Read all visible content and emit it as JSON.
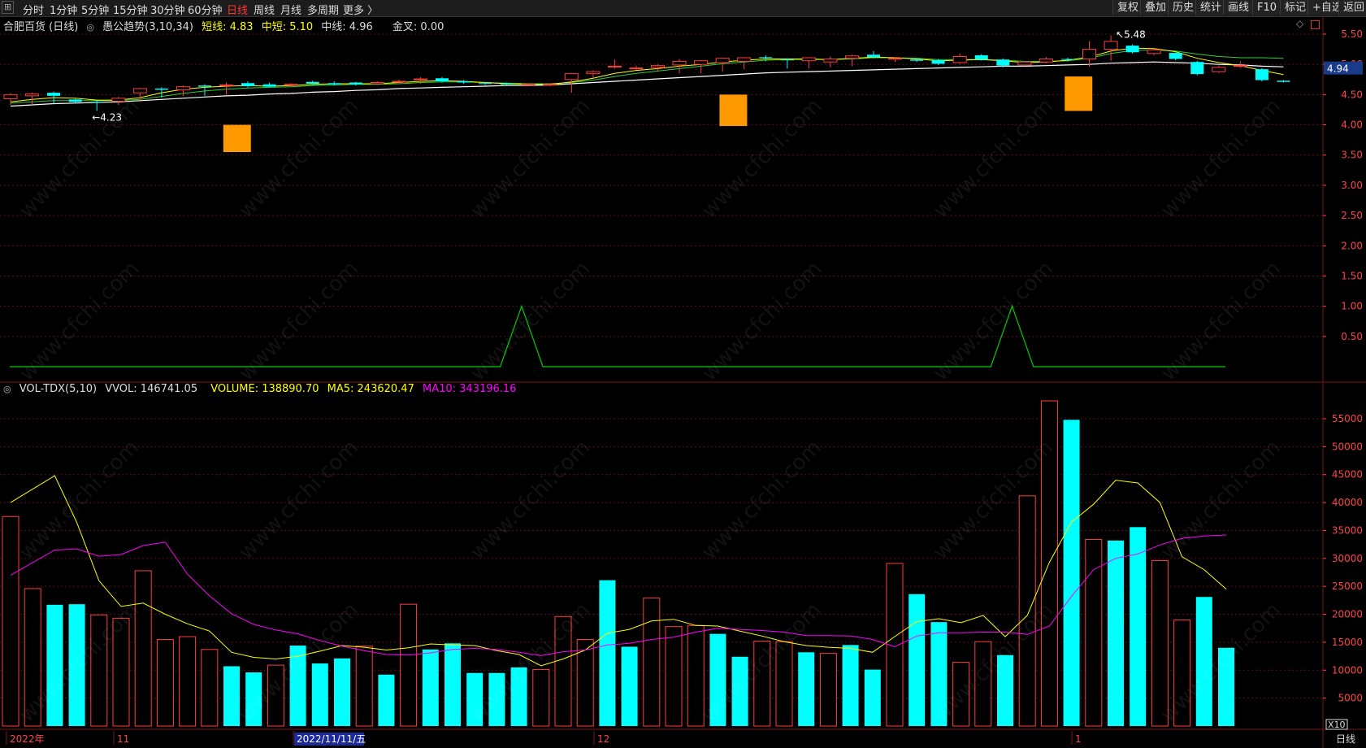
{
  "toolbar": {
    "menu_icon": "window-menu-icon",
    "periods": [
      "分时",
      "1分钟",
      "5分钟",
      "15分钟",
      "30分钟",
      "60分钟",
      "日线",
      "周线",
      "月线",
      "多周期",
      "更多 〉"
    ],
    "active_period": "日线",
    "right_buttons": [
      "复权",
      "叠加",
      "历史",
      "统计",
      "画线",
      "F10",
      "标记",
      "+自选",
      "返回"
    ]
  },
  "price_panel": {
    "stock_name": "合肥百货 (日线)",
    "indicator_name": "愚公趋势(3,10,34)",
    "short_label": "短线: 4.83",
    "mid_short_label": "中短: 5.10",
    "mid_label": "中线: 4.96",
    "golden_cross_label": "金叉: 0.00",
    "high_marker": "5.48",
    "low_marker": "4.23",
    "current_price_tag": "4.94",
    "diamond_icon": "diamond-icon",
    "settings_icon": "square-icon",
    "y_ticks": [
      "5.50",
      "5.00",
      "4.50",
      "4.00",
      "3.50",
      "3.00",
      "2.50",
      "2.00",
      "1.50",
      "1.00",
      "0.50"
    ]
  },
  "volume_panel": {
    "indicator_name": "VOL-TDX(5,10)",
    "vvol_label": "VVOL: 146741.05",
    "volume_label": "VOLUME: 138890.70",
    "ma5_label": "MA5: 243620.47",
    "ma10_label": "MA10: 343196.16",
    "y_ticks": [
      "55000",
      "50000",
      "45000",
      "40000",
      "35000",
      "30000",
      "25000",
      "20000",
      "15000",
      "10000",
      "5000"
    ],
    "unit_badge": "X10"
  },
  "x_axis": {
    "labels": [
      "2022年",
      "11",
      "2022/11/11/五",
      "12",
      "1"
    ],
    "period_badge": "日线"
  },
  "watermark_text": "www.cfchi.com",
  "colors": {
    "up": "#ff3d3d",
    "down": "#00ffff",
    "short_line": "#ffff00",
    "mid_line": "#ffffff",
    "ma10_line": "#ff00ff",
    "signal_line": "#00cc00",
    "block": "#ff9900",
    "grid": "#5a1010",
    "axis_text": "#ff4444"
  },
  "chart_data": {
    "type": "candlestick",
    "price_axis_range": [
      0,
      5.7
    ],
    "volume_axis_range": [
      0,
      59500
    ],
    "candles": [
      {
        "o": 4.43,
        "c": 4.5,
        "h": 4.52,
        "l": 4.33
      },
      {
        "o": 4.48,
        "c": 4.51,
        "h": 4.53,
        "l": 4.33
      },
      {
        "o": 4.53,
        "c": 4.48,
        "h": 4.55,
        "l": 4.35
      },
      {
        "o": 4.42,
        "c": 4.38,
        "h": 4.43,
        "l": 4.36
      },
      {
        "o": 4.38,
        "c": 4.37,
        "h": 4.4,
        "l": 4.23
      },
      {
        "o": 4.39,
        "c": 4.44,
        "h": 4.46,
        "l": 4.33
      },
      {
        "o": 4.53,
        "c": 4.6,
        "h": 4.61,
        "l": 4.38
      },
      {
        "o": 4.6,
        "c": 4.58,
        "h": 4.62,
        "l": 4.45
      },
      {
        "o": 4.58,
        "c": 4.63,
        "h": 4.65,
        "l": 4.48
      },
      {
        "o": 4.65,
        "c": 4.63,
        "h": 4.67,
        "l": 4.48
      },
      {
        "o": 4.65,
        "c": 4.66,
        "h": 4.7,
        "l": 4.5
      },
      {
        "o": 4.69,
        "c": 4.64,
        "h": 4.72,
        "l": 4.62
      },
      {
        "o": 4.67,
        "c": 4.63,
        "h": 4.7,
        "l": 4.62
      },
      {
        "o": 4.66,
        "c": 4.67,
        "h": 4.69,
        "l": 4.64
      },
      {
        "o": 4.71,
        "c": 4.68,
        "h": 4.73,
        "l": 4.66
      },
      {
        "o": 4.69,
        "c": 4.67,
        "h": 4.72,
        "l": 4.65
      },
      {
        "o": 4.7,
        "c": 4.67,
        "h": 4.71,
        "l": 4.65
      },
      {
        "o": 4.68,
        "c": 4.7,
        "h": 4.72,
        "l": 4.66
      },
      {
        "o": 4.71,
        "c": 4.72,
        "h": 4.75,
        "l": 4.68
      },
      {
        "o": 4.76,
        "c": 4.76,
        "h": 4.79,
        "l": 4.68
      },
      {
        "o": 4.77,
        "c": 4.72,
        "h": 4.79,
        "l": 4.7
      },
      {
        "o": 4.72,
        "c": 4.7,
        "h": 4.74,
        "l": 4.68
      },
      {
        "o": 4.69,
        "c": 4.68,
        "h": 4.71,
        "l": 4.66
      },
      {
        "o": 4.68,
        "c": 4.67,
        "h": 4.7,
        "l": 4.65
      },
      {
        "o": 4.67,
        "c": 4.67,
        "h": 4.69,
        "l": 4.64
      },
      {
        "o": 4.66,
        "c": 4.67,
        "h": 4.69,
        "l": 4.64
      },
      {
        "o": 4.75,
        "c": 4.85,
        "h": 4.86,
        "l": 4.53
      },
      {
        "o": 4.85,
        "c": 4.88,
        "h": 4.9,
        "l": 4.78
      },
      {
        "o": 4.97,
        "c": 4.97,
        "h": 5.08,
        "l": 4.93
      },
      {
        "o": 4.94,
        "c": 4.94,
        "h": 4.98,
        "l": 4.91
      },
      {
        "o": 4.95,
        "c": 4.98,
        "h": 5.0,
        "l": 4.88
      },
      {
        "o": 4.99,
        "c": 5.05,
        "h": 5.09,
        "l": 4.85
      },
      {
        "o": 5.0,
        "c": 5.06,
        "h": 5.07,
        "l": 4.85
      },
      {
        "o": 5.03,
        "c": 5.1,
        "h": 5.11,
        "l": 4.88
      },
      {
        "o": 5.05,
        "c": 5.11,
        "h": 5.12,
        "l": 4.92
      },
      {
        "o": 5.12,
        "c": 5.11,
        "h": 5.15,
        "l": 5.05
      },
      {
        "o": 5.08,
        "c": 5.07,
        "h": 5.1,
        "l": 4.93
      },
      {
        "o": 5.06,
        "c": 5.11,
        "h": 5.12,
        "l": 4.93
      },
      {
        "o": 5.04,
        "c": 5.09,
        "h": 5.13,
        "l": 4.95
      },
      {
        "o": 5.1,
        "c": 5.14,
        "h": 5.16,
        "l": 4.97
      },
      {
        "o": 5.16,
        "c": 5.12,
        "h": 5.22,
        "l": 5.1
      },
      {
        "o": 5.09,
        "c": 5.1,
        "h": 5.12,
        "l": 5.04
      },
      {
        "o": 5.08,
        "c": 5.06,
        "h": 5.1,
        "l": 5.04
      },
      {
        "o": 5.07,
        "c": 5.01,
        "h": 5.09,
        "l": 4.99
      },
      {
        "o": 5.03,
        "c": 5.13,
        "h": 5.18,
        "l": 5.01
      },
      {
        "o": 5.15,
        "c": 5.08,
        "h": 5.17,
        "l": 5.06
      },
      {
        "o": 5.08,
        "c": 4.98,
        "h": 5.1,
        "l": 4.95
      },
      {
        "o": 4.99,
        "c": 5.04,
        "h": 5.05,
        "l": 4.97
      },
      {
        "o": 5.04,
        "c": 5.09,
        "h": 5.12,
        "l": 5.02
      },
      {
        "o": 5.09,
        "c": 5.08,
        "h": 5.11,
        "l": 5.05
      },
      {
        "o": 5.09,
        "c": 5.25,
        "h": 5.38,
        "l": 4.96
      },
      {
        "o": 5.25,
        "c": 5.38,
        "h": 5.48,
        "l": 5.06
      },
      {
        "o": 5.31,
        "c": 5.2,
        "h": 5.33,
        "l": 5.18
      },
      {
        "o": 5.18,
        "c": 5.24,
        "h": 5.26,
        "l": 5.15
      },
      {
        "o": 5.19,
        "c": 5.09,
        "h": 5.2,
        "l": 5.07
      },
      {
        "o": 5.04,
        "c": 4.84,
        "h": 5.06,
        "l": 4.82
      },
      {
        "o": 4.88,
        "c": 4.95,
        "h": 4.98,
        "l": 4.86
      },
      {
        "o": 4.97,
        "c": 4.98,
        "h": 5.05,
        "l": 4.94
      },
      {
        "o": 4.92,
        "c": 4.74,
        "h": 4.94,
        "l": 4.72
      },
      {
        "o": 4.73,
        "c": 4.71,
        "h": 4.74,
        "l": 4.7
      }
    ],
    "short_line": [
      4.38,
      4.42,
      4.45,
      4.44,
      4.41,
      4.41,
      4.45,
      4.53,
      4.59,
      4.62,
      4.64,
      4.65,
      4.64,
      4.65,
      4.67,
      4.68,
      4.68,
      4.68,
      4.7,
      4.72,
      4.73,
      4.72,
      4.7,
      4.68,
      4.67,
      4.67,
      4.71,
      4.77,
      4.85,
      4.9,
      4.93,
      4.97,
      5.0,
      5.04,
      5.07,
      5.09,
      5.09,
      5.09,
      5.08,
      5.1,
      5.12,
      5.11,
      5.09,
      5.06,
      5.07,
      5.08,
      5.06,
      5.03,
      5.04,
      5.07,
      5.12,
      5.22,
      5.27,
      5.26,
      5.21,
      5.1,
      5.03,
      4.98,
      4.9,
      4.83
    ],
    "mid_line": [
      4.31,
      4.33,
      4.35,
      4.36,
      4.37,
      4.38,
      4.4,
      4.42,
      4.44,
      4.46,
      4.48,
      4.49,
      4.51,
      4.52,
      4.54,
      4.55,
      4.57,
      4.58,
      4.6,
      4.61,
      4.62,
      4.63,
      4.64,
      4.65,
      4.65,
      4.66,
      4.68,
      4.7,
      4.72,
      4.74,
      4.76,
      4.78,
      4.8,
      4.82,
      4.84,
      4.86,
      4.87,
      4.88,
      4.89,
      4.9,
      4.91,
      4.92,
      4.93,
      4.94,
      4.95,
      4.96,
      4.97,
      4.97,
      4.98,
      4.99,
      5.0,
      5.02,
      5.03,
      5.04,
      5.03,
      5.02,
      5.0,
      4.99,
      4.97,
      4.96
    ],
    "mid_short_line": [
      4.36,
      4.38,
      4.4,
      4.4,
      4.4,
      4.4,
      4.42,
      4.47,
      4.52,
      4.56,
      4.59,
      4.61,
      4.62,
      4.63,
      4.65,
      4.66,
      4.67,
      4.67,
      4.68,
      4.7,
      4.71,
      4.71,
      4.7,
      4.69,
      4.68,
      4.68,
      4.7,
      4.74,
      4.8,
      4.85,
      4.89,
      4.93,
      4.97,
      5.01,
      5.04,
      5.07,
      5.08,
      5.08,
      5.08,
      5.09,
      5.11,
      5.11,
      5.1,
      5.08,
      5.08,
      5.08,
      5.07,
      5.05,
      5.05,
      5.06,
      5.1,
      5.18,
      5.23,
      5.24,
      5.22,
      5.17,
      5.13,
      5.11,
      5.11,
      5.1
    ],
    "signal_blocks": [
      {
        "index": 10,
        "top": 4.0,
        "bottom": 3.55
      },
      {
        "index": 33,
        "top": 4.5,
        "bottom": 3.98
      },
      {
        "index": 49,
        "top": 4.8,
        "bottom": 4.23
      }
    ],
    "signal_line": [
      0,
      0,
      0,
      0,
      0,
      0,
      0,
      0,
      0,
      0,
      0,
      0,
      0,
      0,
      0,
      0,
      0,
      0,
      0,
      0,
      0,
      0,
      0,
      0,
      1,
      0,
      0,
      0,
      0,
      0,
      0,
      0,
      0,
      0,
      0,
      0,
      0,
      0,
      0,
      0,
      0,
      0,
      0,
      0,
      0,
      0,
      0,
      1,
      0,
      0,
      0,
      0,
      0,
      0,
      0,
      0,
      0,
      0
    ],
    "signal_line_start_index": 0,
    "volumes": [
      37500,
      24600,
      21700,
      21800,
      19900,
      19300,
      27800,
      15500,
      16000,
      13700,
      10700,
      9600,
      10900,
      14400,
      11200,
      12100,
      14300,
      9200,
      21800,
      13700,
      14800,
      9500,
      9500,
      10500,
      10100,
      19600,
      15500,
      26100,
      14200,
      22900,
      17800,
      18000,
      16500,
      12400,
      15200,
      15100,
      13200,
      13000,
      14500,
      10100,
      29100,
      23600,
      18600,
      11400,
      15100,
      12700,
      41200,
      58200,
      54800,
      33400,
      33200,
      35600,
      29600,
      19000,
      23100,
      14000
    ],
    "ma5": [
      40000,
      null,
      44800,
      36400,
      26000,
      21400,
      22000,
      20000,
      18300,
      17000,
      13200,
      12300,
      12000,
      12500,
      13400,
      14400,
      14100,
      13600,
      14000,
      14700,
      14500,
      14400,
      13500,
      12800,
      10800,
      12000,
      13600,
      16600,
      17300,
      18800,
      19100,
      18000,
      17900,
      17000,
      16100,
      15100,
      14400,
      14100,
      13900,
      13200,
      16000,
      18700,
      19200,
      18500,
      19800,
      16000,
      19800,
      29300,
      36500,
      39700,
      44000,
      43500,
      40000,
      30300,
      28000,
      24500
    ],
    "ma10": [
      27000,
      null,
      31500,
      31700,
      30400,
      30700,
      32300,
      32900,
      27200,
      23300,
      20100,
      18200,
      17200,
      16500,
      15300,
      14300,
      13500,
      12800,
      12700,
      13100,
      13700,
      13900,
      13700,
      13200,
      12600,
      13300,
      13600,
      14500,
      14800,
      15500,
      15900,
      16800,
      17500,
      17300,
      17100,
      16800,
      16200,
      16200,
      16100,
      15500,
      14200,
      16100,
      16700,
      16700,
      16800,
      16800,
      16400,
      17900,
      23200,
      28000,
      30000,
      30800,
      32400,
      33600,
      34000,
      34200
    ]
  }
}
